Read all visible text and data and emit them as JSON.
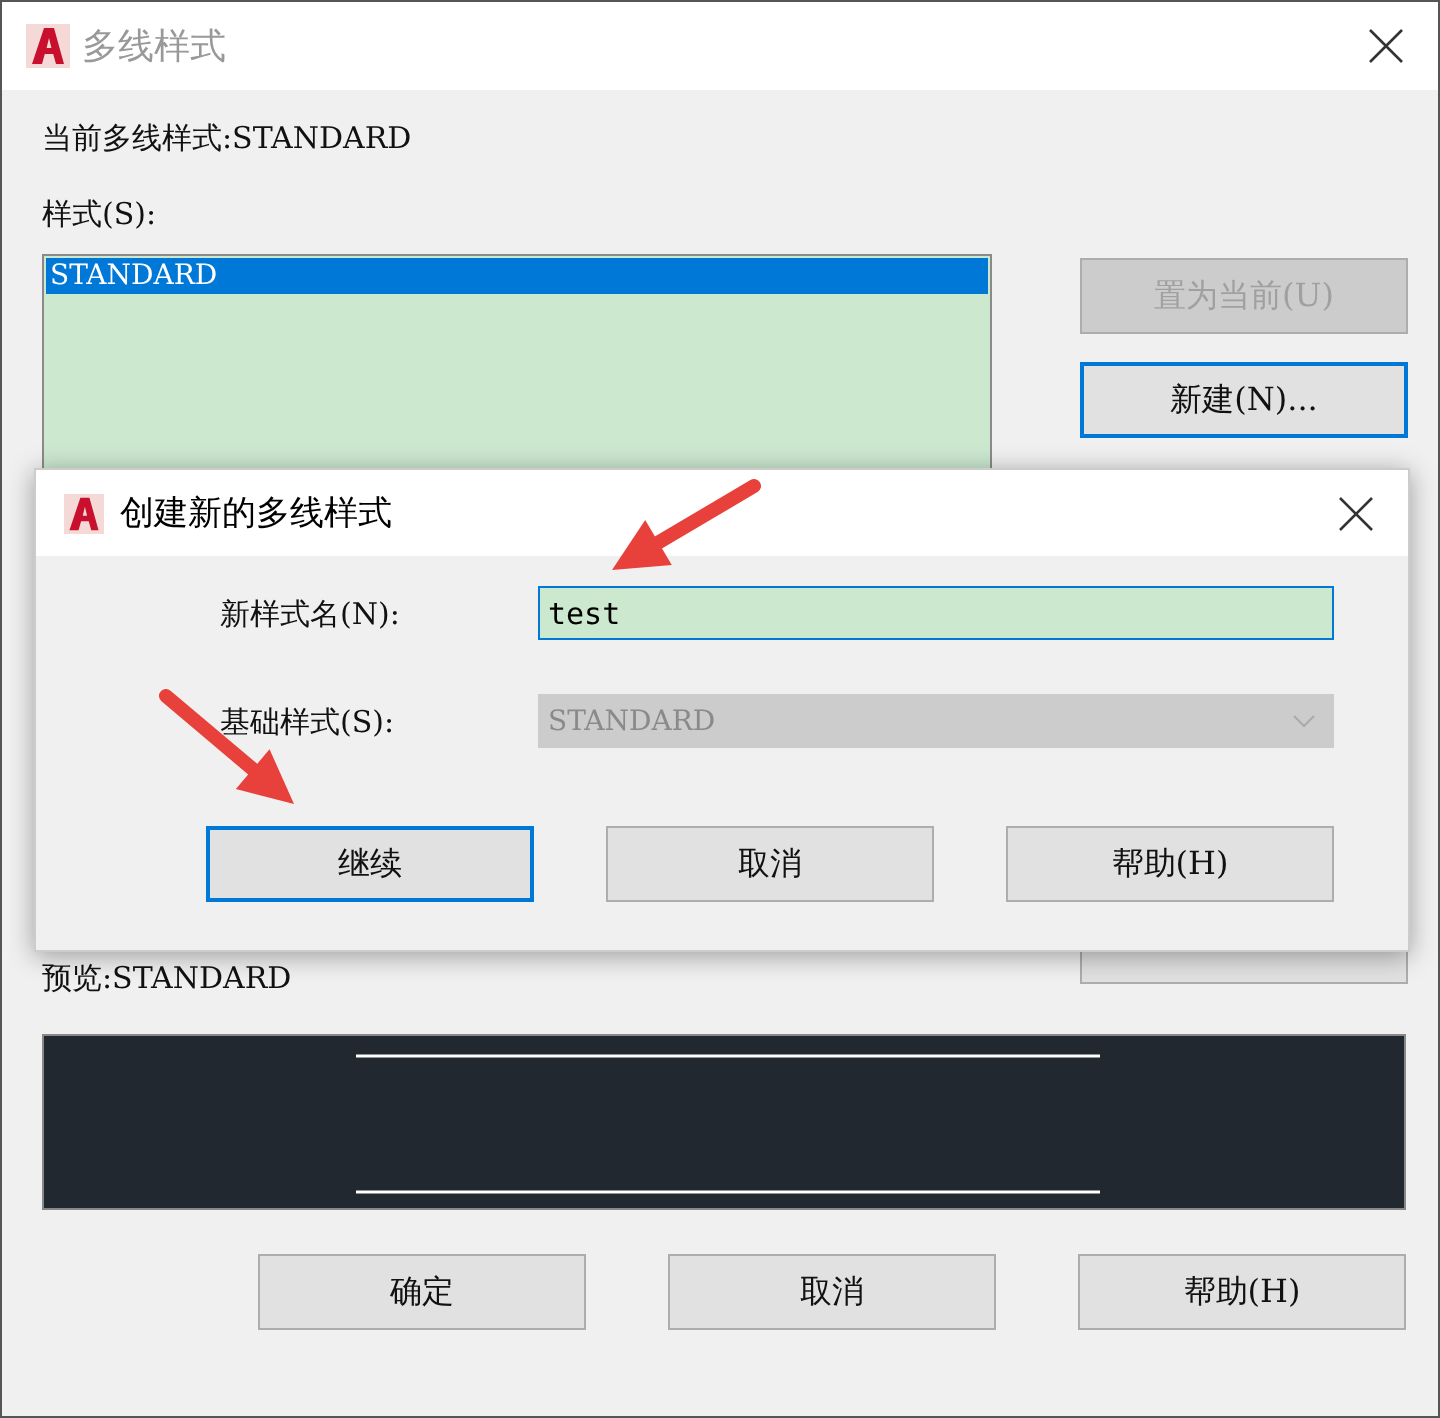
{
  "window": {
    "title": "多线样式"
  },
  "current_style": "当前多线样式:STANDARD",
  "styles_label": "样式(S):",
  "styles": [
    {
      "name": "STANDARD",
      "selected": true
    }
  ],
  "side_buttons": [
    {
      "label": "置为当前(U)",
      "disabled": true,
      "focused": false
    },
    {
      "label": "新建(N)...",
      "disabled": false,
      "focused": true
    }
  ],
  "preview_label": "预览:STANDARD",
  "footer_buttons": [
    {
      "label": "确定"
    },
    {
      "label": "取消"
    },
    {
      "label": "帮助(H)"
    }
  ],
  "dialog": {
    "title": "创建新的多线样式",
    "fields": [
      {
        "kind": "text",
        "label": "新样式名(N):",
        "value": "test",
        "disabled": false
      },
      {
        "kind": "select",
        "label": "基础样式(S):",
        "value": "STANDARD",
        "disabled": true
      }
    ],
    "buttons": [
      {
        "label": "继续",
        "focused": true
      },
      {
        "label": "取消",
        "focused": false
      },
      {
        "label": "帮助(H)",
        "focused": false
      }
    ]
  }
}
